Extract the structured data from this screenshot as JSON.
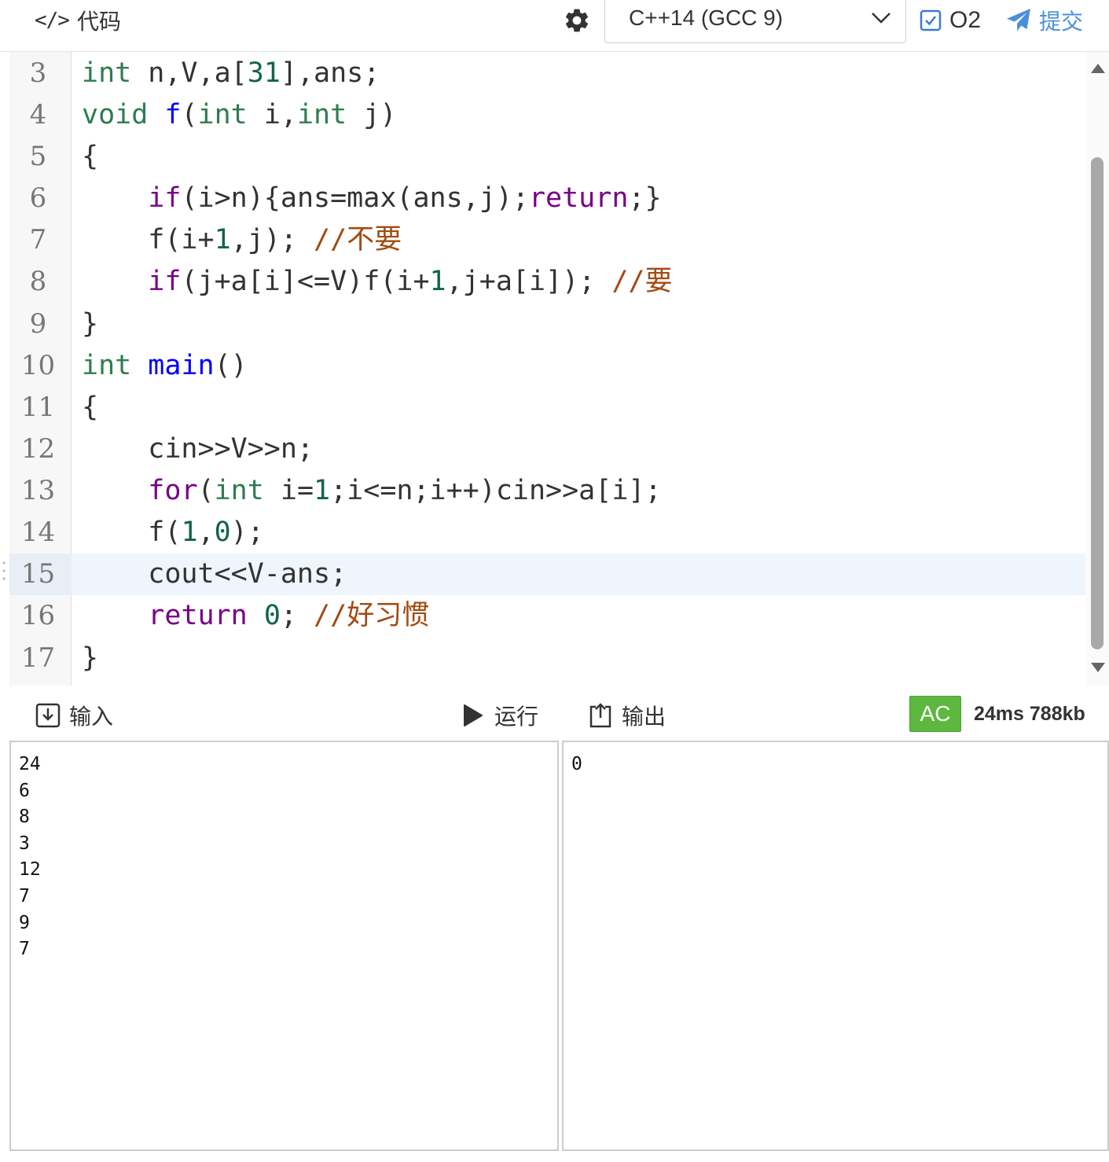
{
  "toolbar": {
    "code_icon": "code-brackets-icon",
    "title": "代码",
    "settings_icon": "gear-icon",
    "language": "C++14 (GCC 9)",
    "o2_label": "O2",
    "o2_checked": true,
    "submit_label": "提交"
  },
  "editor": {
    "active_line": 15,
    "line_numbers": [
      "3",
      "4",
      "5",
      "6",
      "7",
      "8",
      "9",
      "10",
      "11",
      "12",
      "13",
      "14",
      "15",
      "16",
      "17"
    ],
    "lines": [
      "int n,V,a[31],ans;",
      "void f(int i,int j)",
      "{",
      "    if(i>n){ans=max(ans,j);return;}",
      "    f(i+1,j); //不要",
      "    if(j+a[i]<=V)f(i+1,j+a[i]); //要",
      "}",
      "int main()",
      "{",
      "    cin>>V>>n;",
      "    for(int i=1;i<=n;i++)cin>>a[i];",
      "    f(1,0);",
      "    cout<<V-ans;",
      "    return 0; //好习惯",
      "}"
    ]
  },
  "io": {
    "input_label": "输入",
    "run_label": "运行",
    "output_label": "输出",
    "status": "AC",
    "stats": "24ms 788kb",
    "status_color": "#5cb83e",
    "input_text": "24\n6\n8\n3\n12\n7\n9\n7",
    "output_text": "0"
  },
  "colors": {
    "accent": "#3c78d8",
    "submit": "#4a90d9",
    "keyword_type": "#2e7d4f",
    "keyword_control": "#770088",
    "function": "#0000ff",
    "number": "#116644",
    "comment": "#a24b12"
  }
}
